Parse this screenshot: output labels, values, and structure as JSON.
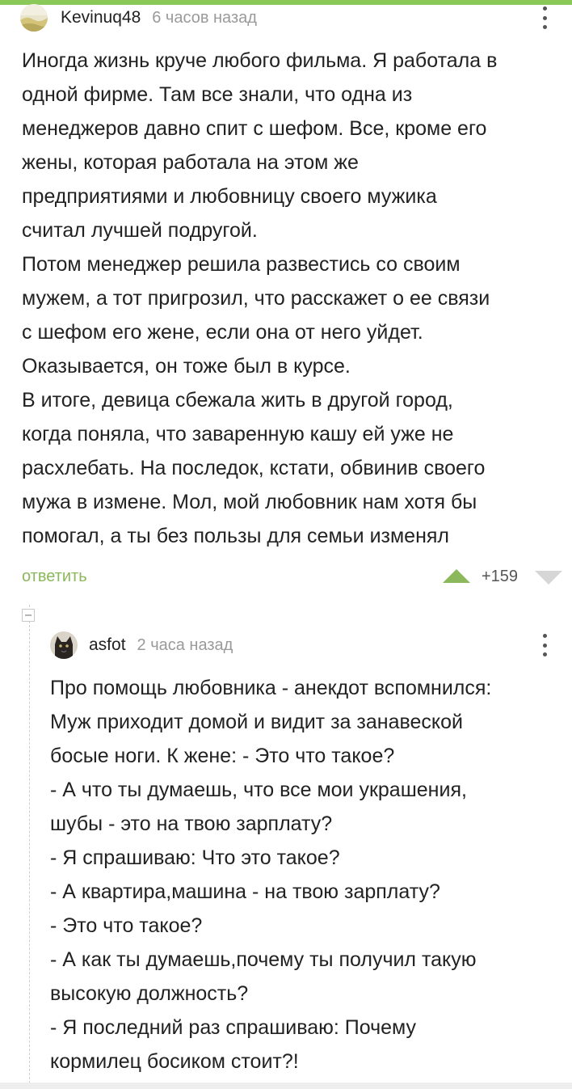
{
  "colors": {
    "accent": "#8ac858",
    "reply_link": "#8ab85a",
    "timestamp": "#9a9a9a",
    "vote_arrow_up": "#8ab85a",
    "vote_arrow_down": "#d6d6d6"
  },
  "comment": {
    "author": "Kevinuq48",
    "time": "6 часов назад",
    "avatar_icon": "avatar-landscape-icon",
    "lines": [
      "Иногда жизнь круче любого фильма. Я работала в",
      "одной фирме. Там все знали, что одна из",
      "менеджеров давно спит с шефом. Все, кроме его",
      "жены, которая работала на этом же",
      "предприятиями и любовницу своего мужика",
      "считал лучшей подругой.",
      "Потом менеджер решила развестись со своим",
      "мужем, а тот пригрозил, что расскажет о ее связи",
      "с шефом его жене, если она от него уйдет.",
      "Оказывается, он тоже был в курсе.",
      "В итоге, девица сбежала жить в другой город,",
      "когда поняла, что заваренную кашу ей уже не",
      "расхлебать. На последок, кстати, обвинив своего",
      "мужа в измене. Мол, мой любовник нам хотя бы",
      "помогал, а ты без пользы для семьи изменял"
    ],
    "reply_label": "ответить",
    "rating": "+159"
  },
  "reply": {
    "author": "asfot",
    "time": "2 часа назад",
    "avatar_icon": "avatar-cat-icon",
    "lines": [
      "Про помощь любовника - анекдот вспомнился:",
      "Муж приходит домой и видит за занавеской",
      "босые ноги. К жене: - Это что такое?",
      "- А что ты думаешь, что все мои украшения,",
      "шубы - это на твою зарплату?",
      "- Я спрашиваю: Что это такое?",
      "- А квартира,машина - на твою зарплату?",
      "- Это что такое?",
      "- А как ты думаешь,почему ты получил такую",
      "высокую должность?",
      "- Я последний раз спрашиваю: Почему",
      "кормилец босиком стоит?!"
    ]
  }
}
